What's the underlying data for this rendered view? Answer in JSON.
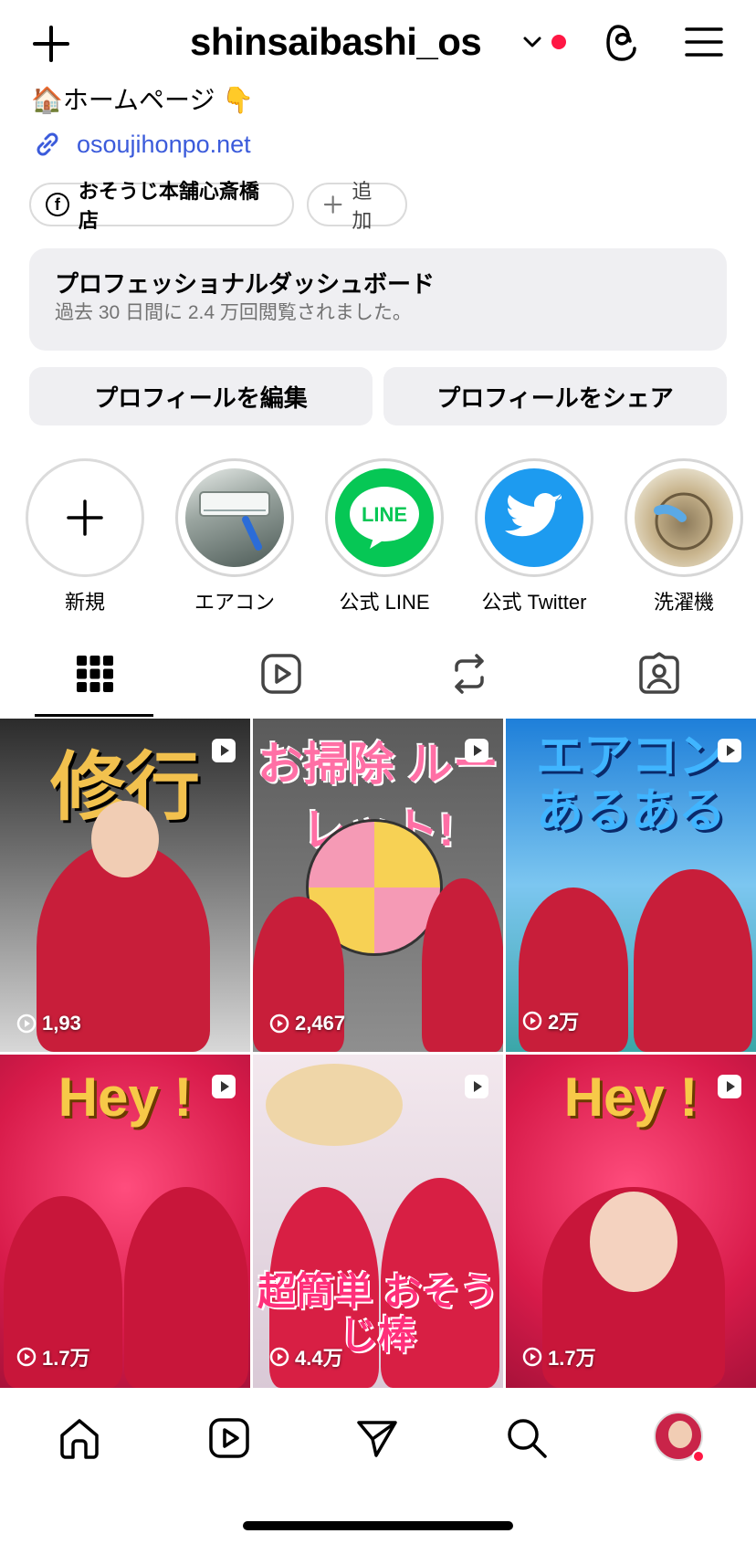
{
  "header": {
    "username": "shinsaibashi_os",
    "icons": [
      "plus-icon",
      "chevron-down-icon",
      "threads-icon",
      "menu-icon"
    ]
  },
  "profile": {
    "bio": "🏠ホームページ 👇",
    "link": "osoujihonpo.net",
    "chips": {
      "facebook": "おそうじ本舗心斎橋店",
      "add": "追加"
    },
    "dashboard": {
      "title": "プロフェッショナルダッシュボード",
      "subtitle": "過去 30 日間に 2.4 万回閲覧されました。"
    },
    "buttons": {
      "edit": "プロフィールを編集",
      "share": "プロフィールをシェア"
    }
  },
  "highlights": [
    {
      "label": "新規"
    },
    {
      "label": "エアコン"
    },
    {
      "label": "公式 LINE"
    },
    {
      "label": "公式 Twitter"
    },
    {
      "label": "洗濯機"
    }
  ],
  "grid": {
    "posts": [
      {
        "views": "1,93",
        "title": "修行"
      },
      {
        "views": "2,467",
        "title": "お掃除 ルーレット!"
      },
      {
        "views": "2万",
        "title": "エアコン あるある"
      },
      {
        "views": "1.7万",
        "title": "Hey !"
      },
      {
        "views": "4.4万",
        "title": "超簡単 おそうじ棒"
      },
      {
        "views": "1.7万",
        "title": "Hey !"
      }
    ]
  },
  "colors": {
    "accent_red": "#ff1744",
    "link_blue": "#3b5bdb",
    "brand_pink": "#d81b4a"
  }
}
